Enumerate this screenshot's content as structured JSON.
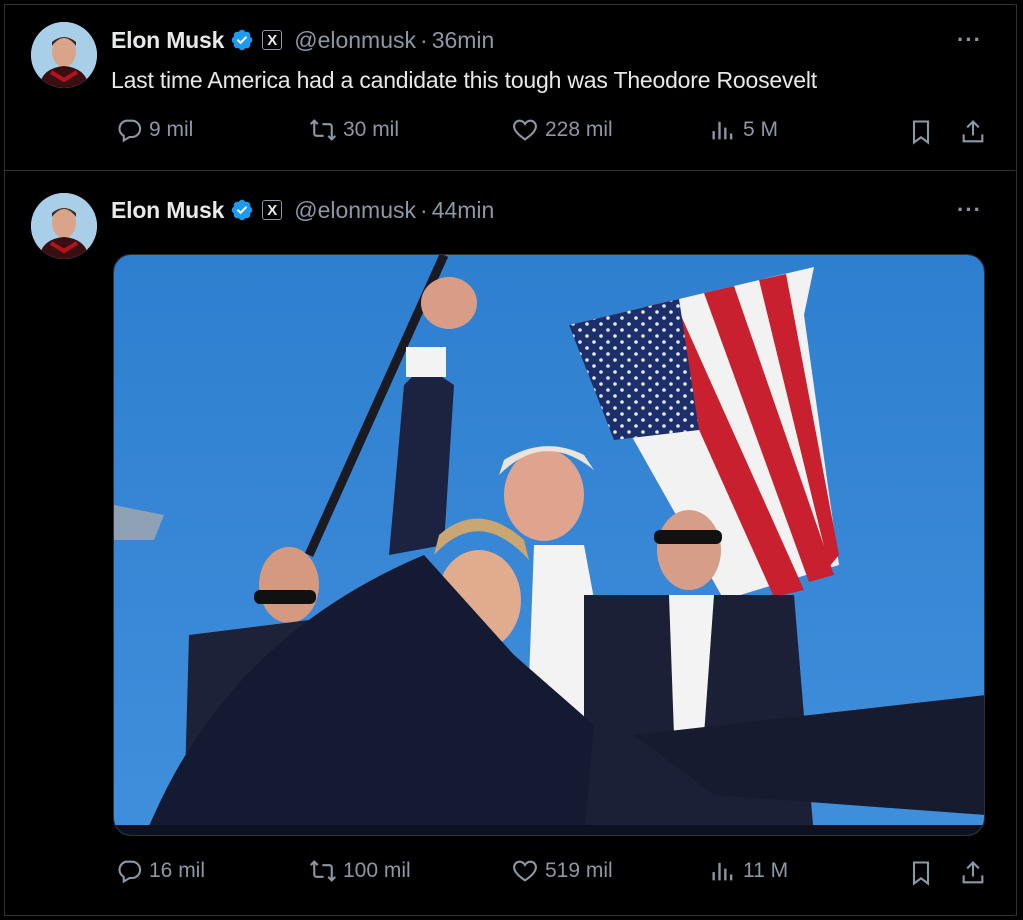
{
  "tweets": [
    {
      "author_name": "Elon Musk",
      "handle": "@elonmusk",
      "separator": "·",
      "time": "36min",
      "text": "Last time America had a candidate this tough was Theodore Roosevelt",
      "replies": "9 mil",
      "reposts": "30 mil",
      "likes": "228 mil",
      "views": "5 M"
    },
    {
      "author_name": "Elon Musk",
      "handle": "@elonmusk",
      "separator": "·",
      "time": "44min",
      "text": "",
      "replies": "16 mil",
      "reposts": "100 mil",
      "likes": "519 mil",
      "views": "11 M"
    }
  ],
  "icons": {
    "verified": "verified-badge-icon",
    "x_badge": "X",
    "more": "···",
    "reply": "reply-icon",
    "repost": "repost-icon",
    "like": "heart-icon",
    "views": "views-icon",
    "bookmark": "bookmark-icon",
    "share": "share-icon"
  },
  "colors": {
    "background": "#000000",
    "text": "#e7e9ea",
    "secondary": "#8b98a5",
    "border": "#2f3336",
    "verified": "#1d9bf0"
  }
}
